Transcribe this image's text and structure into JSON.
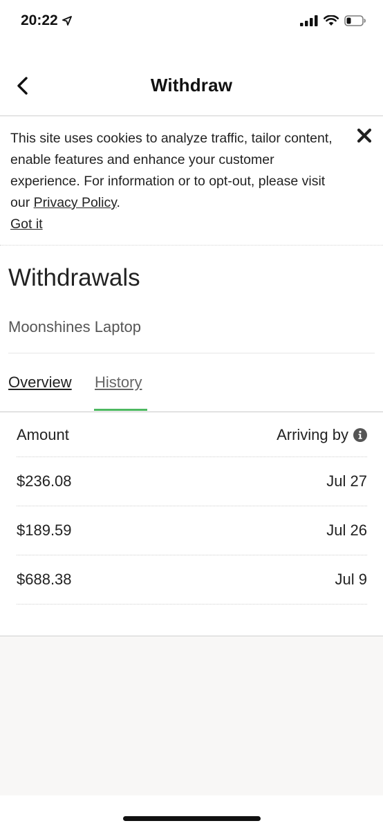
{
  "status_bar": {
    "time": "20:22",
    "icons": [
      "location-arrow-icon",
      "cellular-signal-icon",
      "wifi-icon",
      "battery-icon"
    ]
  },
  "header": {
    "title": "Withdraw",
    "back_icon": "chevron-left-icon"
  },
  "cookie_banner": {
    "text": "This site uses cookies to analyze traffic, tailor content, enable features and enhance your customer experience. For information or to opt-out, please visit our ",
    "link_label": "Privacy Policy",
    "text_end": ".",
    "dismiss_label": "Got it",
    "close_icon": "close-icon"
  },
  "main": {
    "heading": "Withdrawals",
    "account": "Moonshines Laptop",
    "tabs": [
      {
        "label": "Overview",
        "active": false
      },
      {
        "label": "History",
        "active": true
      }
    ],
    "accent_color": "#4cb860"
  },
  "table": {
    "columns": [
      "Amount",
      "Arriving by"
    ],
    "info_icon": "info-icon",
    "rows": [
      {
        "amount": "$236.08",
        "date": "Jul 27"
      },
      {
        "amount": "$189.59",
        "date": "Jul 26"
      },
      {
        "amount": "$688.38",
        "date": "Jul 9"
      }
    ]
  }
}
